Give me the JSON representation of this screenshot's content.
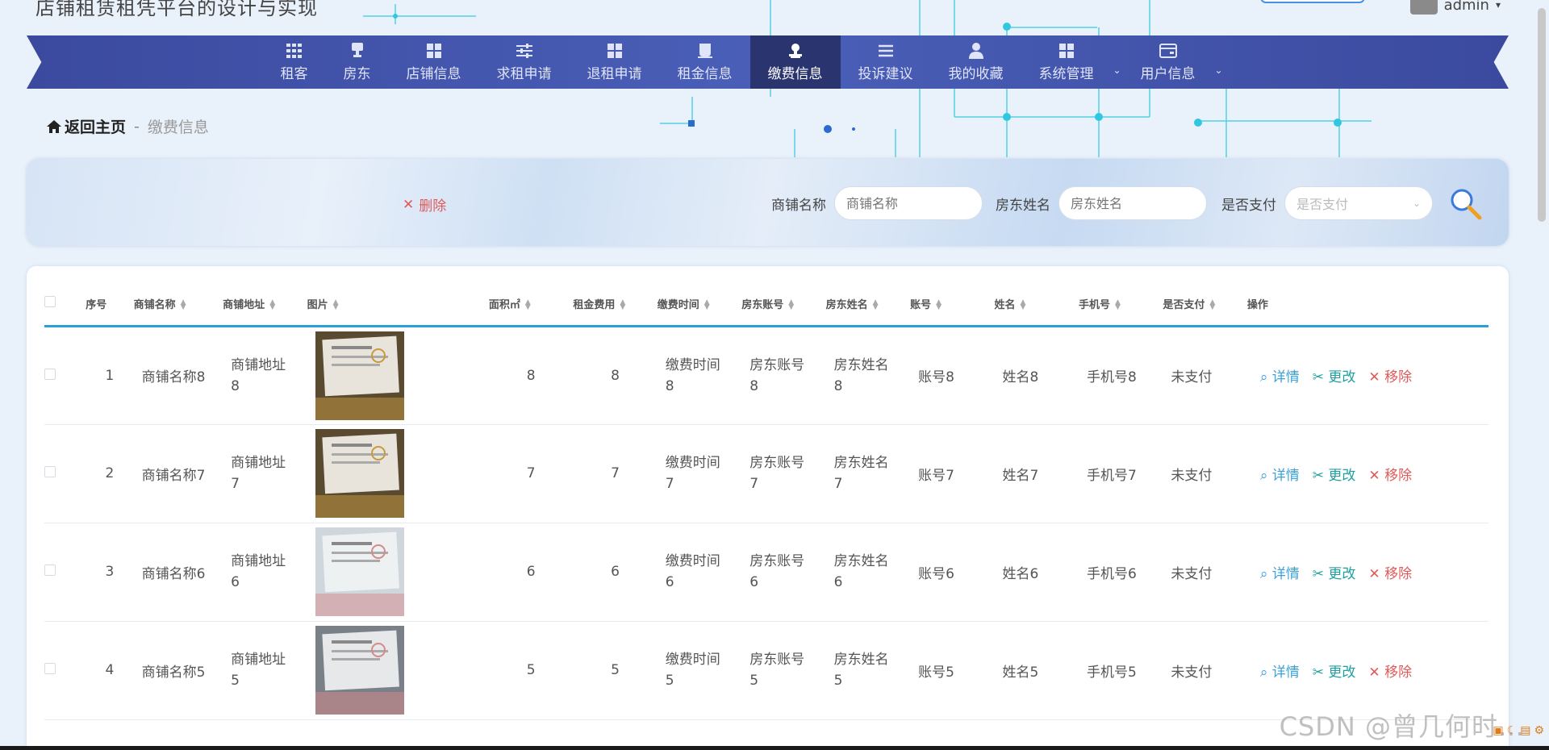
{
  "app": {
    "title": "店铺租赁租凭平台的设计与实现",
    "user": "admin",
    "watermark": "CSDN @曾几何时…"
  },
  "nav": {
    "items": [
      {
        "label": "租客",
        "icon": "grid-icon"
      },
      {
        "label": "房东",
        "icon": "stamp-icon"
      },
      {
        "label": "店铺信息",
        "icon": "grid-icon"
      },
      {
        "label": "求租申请",
        "icon": "sliders-icon"
      },
      {
        "label": "退租申请",
        "icon": "grid-icon"
      },
      {
        "label": "租金信息",
        "icon": "cup-icon"
      },
      {
        "label": "缴费信息",
        "icon": "person-stamp-icon",
        "active": true
      },
      {
        "label": "投诉建议",
        "icon": "list-icon"
      },
      {
        "label": "我的收藏",
        "icon": "user-icon"
      },
      {
        "label": "系统管理",
        "icon": "grid-icon",
        "caret": true
      },
      {
        "label": "用户信息",
        "icon": "card-icon",
        "caret": true
      }
    ]
  },
  "breadcrumb": {
    "home": "返回主页",
    "sep": "-",
    "current": "缴费信息"
  },
  "search": {
    "delete_label": "删除",
    "shop_name_label": "商铺名称",
    "shop_name_placeholder": "商铺名称",
    "landlord_label": "房东姓名",
    "landlord_placeholder": "房东姓名",
    "paid_label": "是否支付",
    "paid_placeholder": "是否支付"
  },
  "table": {
    "headers": [
      "序号",
      "商铺名称",
      "商铺地址",
      "图片",
      "面积㎡",
      "租金费用",
      "缴费时间",
      "房东账号",
      "房东姓名",
      "账号",
      "姓名",
      "手机号",
      "是否支付",
      "操作"
    ],
    "rows": [
      {
        "idx": "1",
        "shop": "商铺名称8",
        "addr": "商铺地址8",
        "area": "8",
        "rent": "8",
        "time": "缴费时间8",
        "lacct": "房东账号8",
        "lname": "房东姓名8",
        "acct": "账号8",
        "name": "姓名8",
        "phone": "手机号8",
        "paid": "未支付"
      },
      {
        "idx": "2",
        "shop": "商铺名称7",
        "addr": "商铺地址7",
        "area": "7",
        "rent": "7",
        "time": "缴费时间7",
        "lacct": "房东账号7",
        "lname": "房东姓名7",
        "acct": "账号7",
        "name": "姓名7",
        "phone": "手机号7",
        "paid": "未支付"
      },
      {
        "idx": "3",
        "shop": "商铺名称6",
        "addr": "商铺地址6",
        "area": "6",
        "rent": "6",
        "time": "缴费时间6",
        "lacct": "房东账号6",
        "lname": "房东姓名6",
        "acct": "账号6",
        "name": "姓名6",
        "phone": "手机号6",
        "paid": "未支付"
      },
      {
        "idx": "4",
        "shop": "商铺名称5",
        "addr": "商铺地址5",
        "area": "5",
        "rent": "5",
        "time": "缴费时间5",
        "lacct": "房东账号5",
        "lname": "房东姓名5",
        "acct": "账号5",
        "name": "姓名5",
        "phone": "手机号5",
        "paid": "未支付"
      }
    ],
    "ops": {
      "detail": "详情",
      "edit": "更改",
      "remove": "移除"
    }
  },
  "colors": {
    "nav": "#3b4a9e",
    "nav_active": "#2a3570",
    "accent": "#2aa0d8",
    "danger": "#e05a5a"
  }
}
